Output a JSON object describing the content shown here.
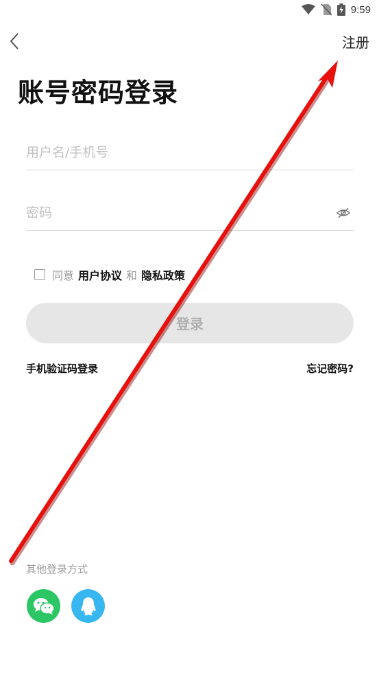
{
  "status_bar": {
    "time": "9:59"
  },
  "header": {
    "register_label": "注册"
  },
  "title": "账号密码登录",
  "form": {
    "username_placeholder": "用户名/手机号",
    "password_placeholder": "密码"
  },
  "agreement": {
    "prefix": "同意",
    "user_agreement": "用户协议",
    "and": "和",
    "privacy_policy": "隐私政策"
  },
  "login_button_label": "登录",
  "links": {
    "sms_login": "手机验证码登录",
    "forgot_password": "忘记密码?"
  },
  "other_login": {
    "label": "其他登录方式",
    "methods": [
      "wechat-icon",
      "qq-icon"
    ]
  },
  "colors": {
    "wechat": "#2dc665",
    "qq": "#38b6f0",
    "arrow": "#e8100c",
    "button_disabled_bg": "#e6e6e6"
  }
}
